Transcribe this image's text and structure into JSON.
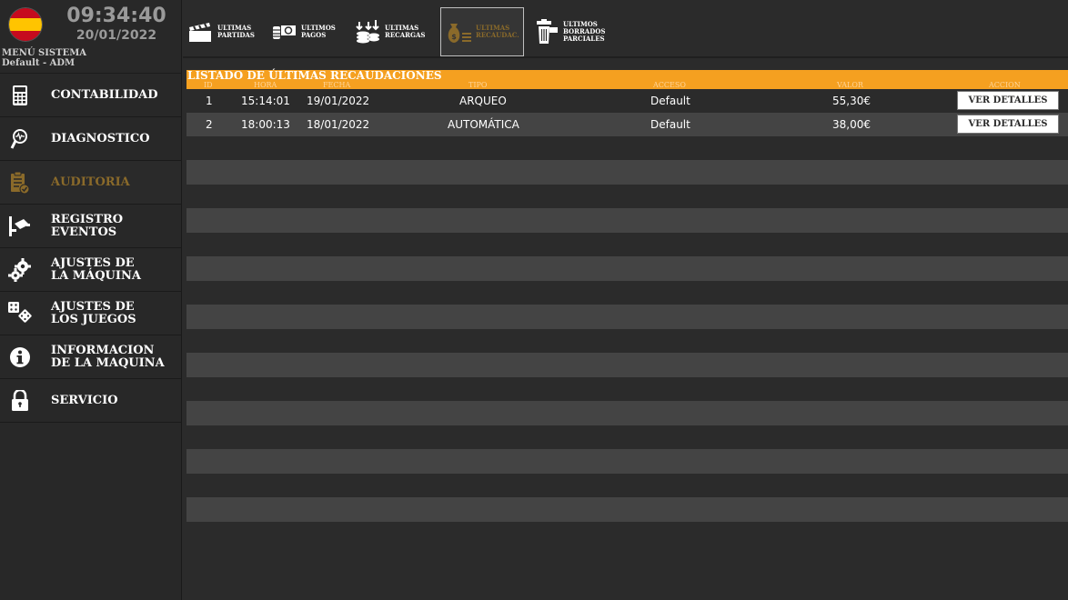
{
  "header": {
    "time": "09:34:40",
    "date": "20/01/2022",
    "menu_title": "MENÚ SISTEMA",
    "user": "Default - ADM"
  },
  "sidebar": {
    "items": [
      {
        "label": "CONTABILIDAD",
        "icon": "calculator-icon"
      },
      {
        "label": "DIAGNOSTICO",
        "icon": "magnifier-icon"
      },
      {
        "label": "AUDITORIA",
        "icon": "clipboard-check-icon",
        "active": true
      },
      {
        "label": "REGISTRO\nEVENTOS",
        "icon": "camera-icon"
      },
      {
        "label": "AJUSTES DE\nLA MÁQUINA",
        "icon": "gears-icon"
      },
      {
        "label": "AJUSTES DE\nLOS JUEGOS",
        "icon": "dice-icon"
      },
      {
        "label": "INFORMACION\nDE LA MAQUINA",
        "icon": "info-icon"
      },
      {
        "label": "SERVICIO",
        "icon": "lock-icon"
      }
    ]
  },
  "toolbar": {
    "buttons": [
      {
        "label": "ULTIMAS\nPARTIDAS",
        "icon": "clapperboard-icon"
      },
      {
        "label": "ULTIMOS\nPAGOS",
        "icon": "cash-icon"
      },
      {
        "label": "ULTIMAS\nRECARGAS",
        "icon": "coins-icon"
      },
      {
        "label": "ULTIMAS\nRECAUDAC.",
        "icon": "money-bag-icon",
        "active": true
      },
      {
        "label": "ULTIMOS\nBORRADOS\nPARCIALES",
        "icon": "trash-icon"
      }
    ]
  },
  "table": {
    "title": "LISTADO DE ÚLTIMAS RECAUDACIONES",
    "columns": {
      "id": "ID",
      "hora": "HORA",
      "fecha": "FECHA",
      "tipo": "TIPO",
      "acceso": "ACCESO",
      "valor": "VALOR",
      "accion": "ACCION"
    },
    "rows": [
      {
        "id": "1",
        "hora": "15:14:01",
        "fecha": "19/01/2022",
        "tipo": "ARQUEO",
        "acceso": "Default",
        "valor": "55,30€",
        "action": "VER DETALLES"
      },
      {
        "id": "2",
        "hora": "18:00:13",
        "fecha": "18/01/2022",
        "tipo": "AUTOMÁTICA",
        "acceso": "Default",
        "valor": "38,00€",
        "action": "VER DETALLES"
      }
    ]
  },
  "colors": {
    "accent": "#f5a020",
    "active_text": "#8a6a2a",
    "background": "#2b2b2b",
    "row_fill": "#444444"
  }
}
